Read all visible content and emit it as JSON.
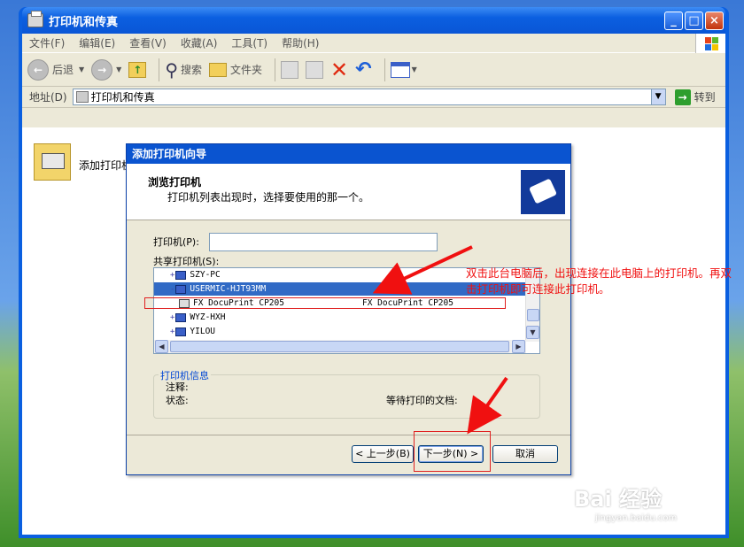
{
  "window": {
    "title": "打印机和传真",
    "menu": [
      "文件(F)",
      "编辑(E)",
      "查看(V)",
      "收藏(A)",
      "工具(T)",
      "帮助(H)"
    ],
    "toolbar": {
      "back": "后退",
      "search": "搜索",
      "folders": "文件夹"
    },
    "address": {
      "label": "地址(D)",
      "value": "打印机和传真",
      "go": "转到"
    }
  },
  "content": {
    "add_printer": "添加打印机"
  },
  "wizard": {
    "title": "添加打印机向导",
    "heading": "浏览打印机",
    "subheading": "打印机列表出现时，选择要使用的那一个。",
    "printer_label": "打印机(P):",
    "shared_label": "共享打印机(S):",
    "tree": [
      {
        "name": "SZY-PC",
        "comment": ""
      },
      {
        "name": "USERMIC-HJT93MM",
        "comment": ""
      },
      {
        "name": "FX DocuPrint CP205",
        "comment": "FX DocuPrint CP205"
      },
      {
        "name": "WYZ-HXH",
        "comment": ""
      },
      {
        "name": "YILOU",
        "comment": ""
      }
    ],
    "info_group": "打印机信息",
    "comment_label": "注释:",
    "status_label": "状态:",
    "queue_label": "等待打印的文档:",
    "btn_back": "< 上一步(B)",
    "btn_next": "下一步(N) >",
    "btn_cancel": "取消"
  },
  "annotation": "双击此台电脑后，出现连接在此电脑上的打印机。再双击打印机即可连接此打印机。",
  "watermark": {
    "logo": "Bai 经验",
    "url": "jingyan.baidu.com"
  },
  "colors": {
    "annotation": "#f01010",
    "titlebar": "#0a5fe0",
    "selection": "#316ac5"
  }
}
